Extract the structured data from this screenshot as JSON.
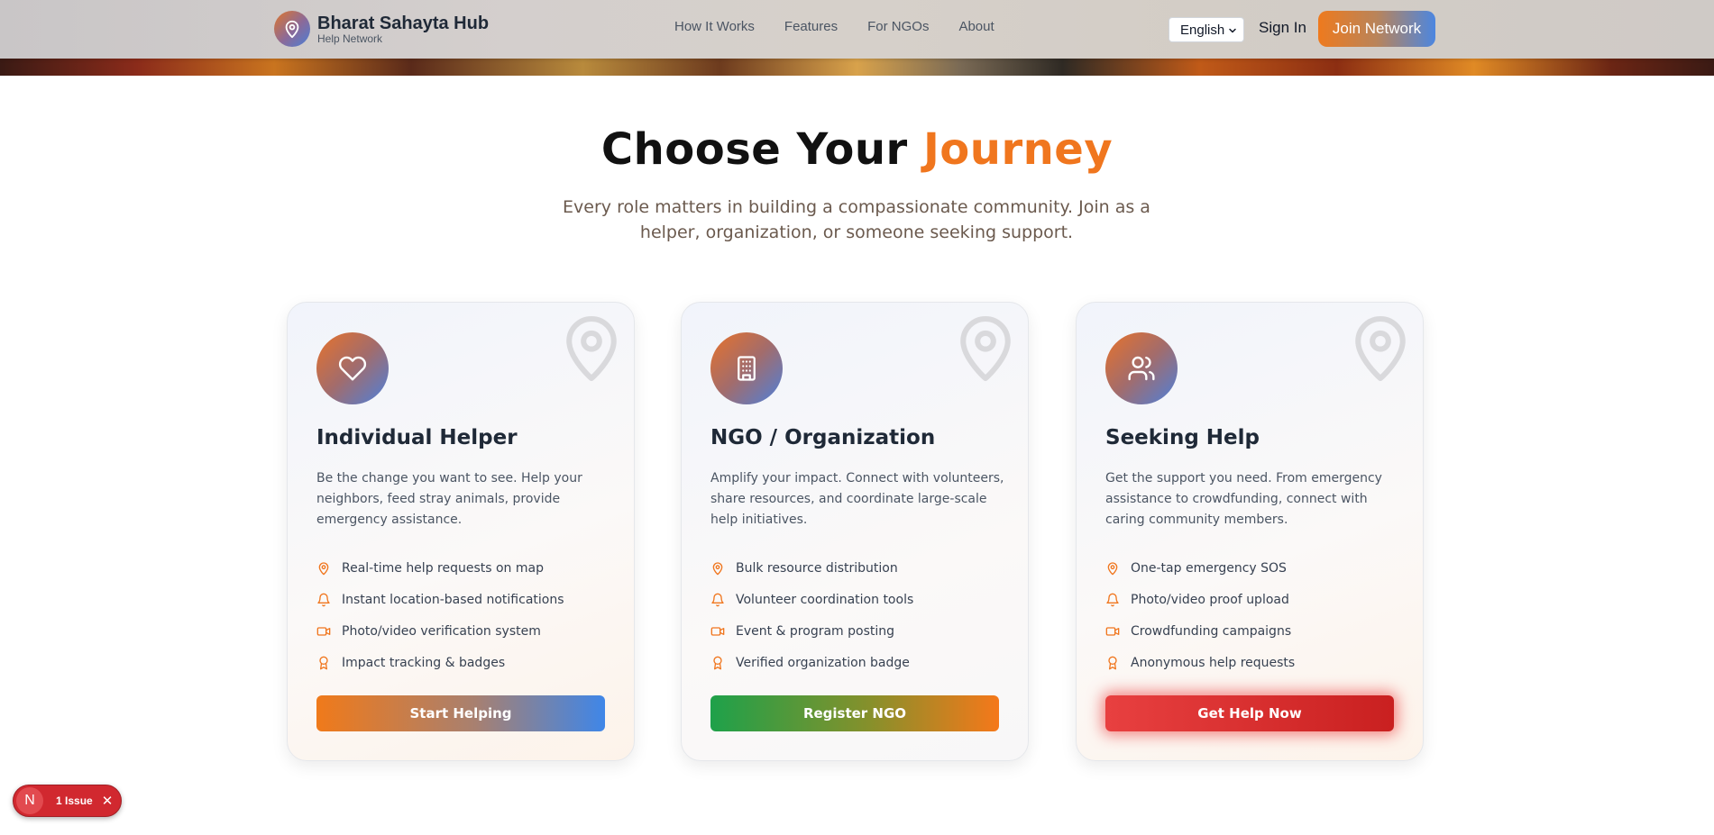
{
  "header": {
    "brand_name": "Bharat Sahayta Hub",
    "brand_sub": "Help Network",
    "nav": [
      "How It Works",
      "Features",
      "For NGOs",
      "About"
    ],
    "language": "English",
    "sign_in": "Sign In",
    "join": "Join Network"
  },
  "section": {
    "title_main": "Choose Your ",
    "title_accent": "Journey",
    "subtitle": "Every role matters in building a compassionate community. Join as a helper, organization, or someone seeking support."
  },
  "cards": [
    {
      "title": "Individual Helper",
      "description": "Be the change you want to see. Help your neighbors, feed stray animals, provide emergency assistance.",
      "features": [
        "Real-time help requests on map",
        "Instant location-based notifications",
        "Photo/video verification system",
        "Impact tracking & badges"
      ],
      "button": "Start Helping"
    },
    {
      "title": "NGO / Organization",
      "description": "Amplify your impact. Connect with volunteers, share resources, and coordinate large-scale help initiatives.",
      "features": [
        "Bulk resource distribution",
        "Volunteer coordination tools",
        "Event & program posting",
        "Verified organization badge"
      ],
      "button": "Register NGO"
    },
    {
      "title": "Seeking Help",
      "description": "Get the support you need. From emergency assistance to crowdfunding, connect with caring community members.",
      "features": [
        "One-tap emergency SOS",
        "Photo/video proof upload",
        "Crowdfunding campaigns",
        "Anonymous help requests"
      ],
      "button": "Get Help Now"
    }
  ],
  "issue_badge": {
    "initial": "N",
    "label": "1 Issue"
  },
  "colors": {
    "accent": "#f0761e",
    "brand_blue": "#4c86e0",
    "ngo_green": "#1ea14a",
    "danger": "#d1282f"
  },
  "icons": {
    "brand": "map-pin-icon",
    "card_icons": [
      "heart-icon",
      "building-icon",
      "users-icon"
    ],
    "feature_icons": [
      "map-pin-icon",
      "bell-icon",
      "video-icon",
      "award-icon"
    ]
  }
}
